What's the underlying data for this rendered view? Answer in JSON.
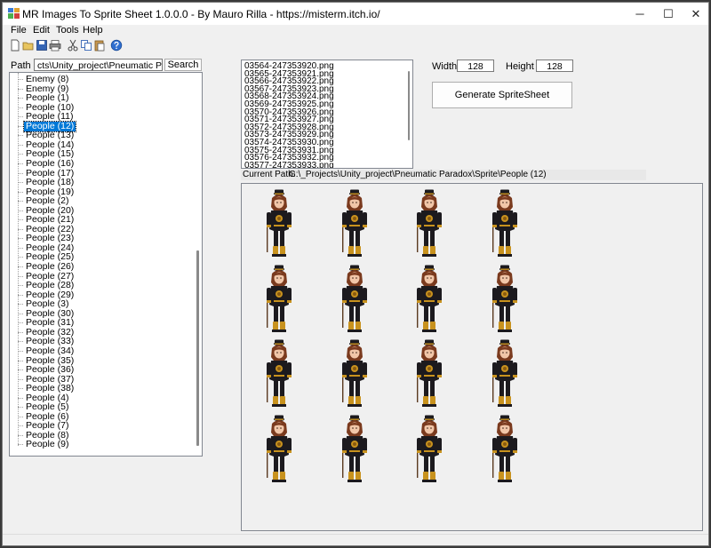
{
  "window": {
    "title": "MR Images To Sprite Sheet 1.0.0.0 - By Mauro Rilla - https://misterm.itch.io/",
    "minimize_glyph": "─",
    "maximize_glyph": "☐",
    "close_glyph": "✕"
  },
  "menu": {
    "file": "File",
    "edit": "Edit",
    "tools": "Tools",
    "help": "Help"
  },
  "toolbar": {
    "icons": [
      "new-icon",
      "open-icon",
      "save-icon",
      "print-icon",
      "cut-icon",
      "copy-icon",
      "paste-icon",
      "help-icon"
    ]
  },
  "path": {
    "label": "Path :",
    "value": "cts\\Unity_project\\Pneumatic Paradox\\Sprite",
    "search_label": "Search"
  },
  "tree": {
    "items": [
      "Enemy (8)",
      "Enemy (9)",
      "People (1)",
      "People (10)",
      "People (11)",
      "People (12)",
      "People (13)",
      "People (14)",
      "People (15)",
      "People (16)",
      "People (17)",
      "People (18)",
      "People (19)",
      "People (2)",
      "People (20)",
      "People (21)",
      "People (22)",
      "People (23)",
      "People (24)",
      "People (25)",
      "People (26)",
      "People (27)",
      "People (28)",
      "People (29)",
      "People (3)",
      "People (30)",
      "People (31)",
      "People (32)",
      "People (33)",
      "People (34)",
      "People (35)",
      "People (36)",
      "People (37)",
      "People (38)",
      "People (4)",
      "People (5)",
      "People (6)",
      "People (7)",
      "People (8)",
      "People (9)"
    ],
    "selected": "People (12)"
  },
  "files": {
    "items": [
      "03564-247353920.png",
      "03565-247353921.png",
      "03566-247353922.png",
      "03567-247353923.png",
      "03568-247353924.png",
      "03569-247353925.png",
      "03570-247353926.png",
      "03571-247353927.png",
      "03572-247353928.png",
      "03573-247353929.png",
      "03574-247353930.png",
      "03575-247353931.png",
      "03576-247353932.png",
      "03577-247353933.png"
    ]
  },
  "size": {
    "width_label": "Width :",
    "width_value": "128",
    "height_label": "Height :",
    "height_value": "128",
    "generate_label": "Generate SpriteSheet"
  },
  "current_path": {
    "label": "Current Path:",
    "value": "G:\\_Projects\\Unity_project\\Pneumatic Paradox\\Sprite\\People (12)"
  },
  "colors": {
    "selection": "#0078d7",
    "coat": "#1c1a1e",
    "gold": "#c8921e",
    "hair": "#7a3a1e",
    "skin": "#f1c6a8"
  }
}
